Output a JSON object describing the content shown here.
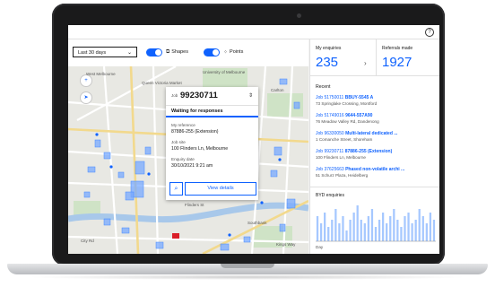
{
  "app": {
    "help_icon": "help-icon"
  },
  "filters": {
    "date_range": "Last 30 days",
    "shapes_label": "Shapes",
    "points_label": "Points",
    "shapes_on": true,
    "points_on": true
  },
  "map": {
    "labels": [
      "West Melbourne",
      "Queen Victoria Market",
      "University of Melbourne",
      "Carlton",
      "Flinders St",
      "Southbank",
      "City Rd",
      "Kings Way"
    ]
  },
  "popup": {
    "job_prefix": "Job",
    "job_number": "99230711",
    "status": "Waiting for responses",
    "ref_label": "My reference",
    "ref_value": "87886-255 (Extension)",
    "site_label": "Job site",
    "site_value": "100 Flinders Ln, Melbourne",
    "date_label": "Enquiry date",
    "date_value": "30/10/2021  9:21 am",
    "details_button": "View details"
  },
  "panel": {
    "enquiries_title": "My enquiries",
    "enquiries_count": "235",
    "referrals_title": "Referrals made",
    "referrals_count": "1927",
    "recent_title": "Recent",
    "recent": [
      {
        "job": "Job 51750011",
        "tag": "BBUY-5545 A",
        "addr": "73 Springlake Crossing, Montford"
      },
      {
        "job": "Job 51749016",
        "tag": "9644-557A90",
        "addr": "76 Meadow Valley Rd, Dandenong"
      },
      {
        "job": "Job 96330050",
        "tag": "Multi-lateral dedicated ...",
        "addr": "1 Comanche Street, Shoreham"
      },
      {
        "job": "Job 99230711",
        "tag": "87886-255 (Extension)",
        "addr": "100 Flinders Ln, Melbourne"
      },
      {
        "job": "Job 37625663",
        "tag": "Phased non-volatile archi ...",
        "addr": "51 Schurz Plaza, Heidelberg"
      }
    ],
    "chart_title": "BYD enquiries",
    "day_label": "Day"
  },
  "chart_data": {
    "type": "bar",
    "title": "BYD enquiries",
    "xlabel": "Day",
    "values": [
      7,
      5,
      8,
      4,
      6,
      9,
      5,
      7,
      3,
      6,
      8,
      10,
      6,
      5,
      7,
      9,
      4,
      6,
      8,
      5,
      7,
      9,
      6,
      4,
      7,
      8,
      5,
      6,
      9,
      7,
      5,
      8,
      6
    ]
  }
}
